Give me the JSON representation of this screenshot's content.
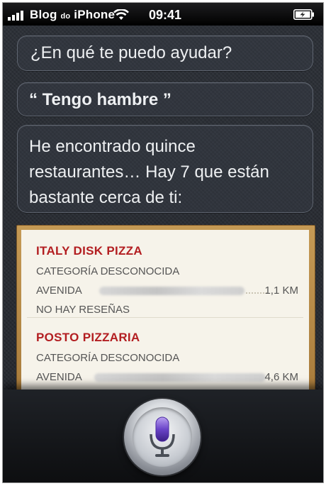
{
  "status_bar": {
    "carrier_prefix": "Blog",
    "carrier_do": "do",
    "carrier_suffix": "iPhone",
    "time": "09:41",
    "icons": [
      "signal-bars-icon",
      "wifi-icon",
      "battery-charging-icon"
    ]
  },
  "conversation": {
    "siri_prompt": "¿En qué te puedo ayudar?",
    "user_query": "“ Tengo hambre ”",
    "siri_reply": "He encontrado quince restaurantes… Hay 7 que están bastante cerca de ti:"
  },
  "restaurants": [
    {
      "name": "ITALY DISK PIZZA",
      "category": "CATEGORÍA DESCONOCIDA",
      "street_label": "AVENIDA",
      "distance": "1,1 KM",
      "reviews": "NO HAY RESEÑAS"
    },
    {
      "name": "POSTO PIZZARIA",
      "category": "CATEGORÍA DESCONOCIDA",
      "street_label": "AVENIDA",
      "distance": "4,6 KM"
    }
  ],
  "colors": {
    "restaurant_name": "#b31e21",
    "card_frame": "#b8894a",
    "card_paper": "#f6f3ea"
  },
  "controls": {
    "mic_icon": "microphone-icon"
  }
}
